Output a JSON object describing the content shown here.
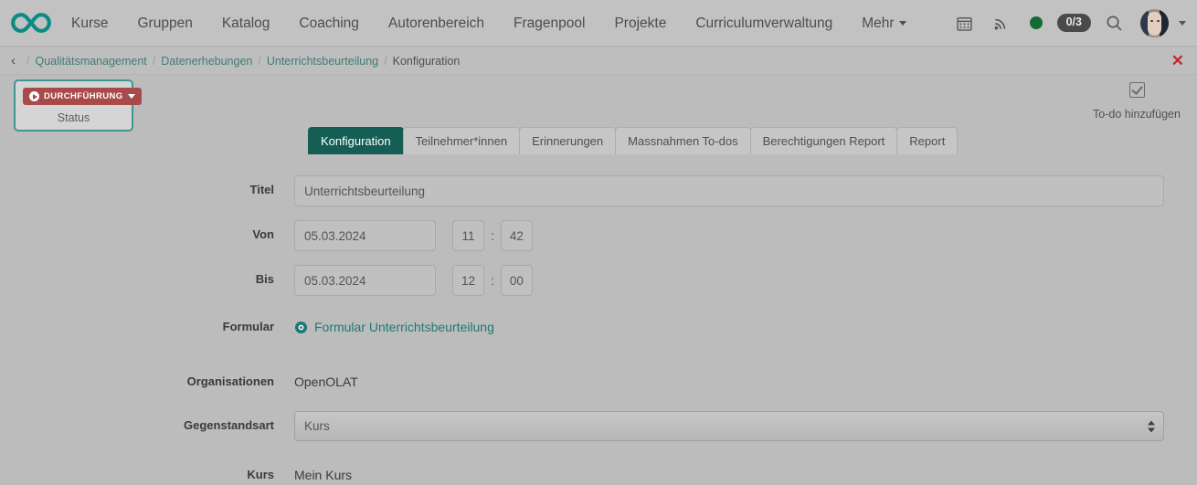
{
  "navbar": {
    "logo_name": "openolat-infinity-logo",
    "links": [
      {
        "label": "Kurse",
        "name": "nav-kurse"
      },
      {
        "label": "Gruppen",
        "name": "nav-gruppen"
      },
      {
        "label": "Katalog",
        "name": "nav-katalog"
      },
      {
        "label": "Coaching",
        "name": "nav-coaching"
      },
      {
        "label": "Autorenbereich",
        "name": "nav-autorenbereich"
      },
      {
        "label": "Fragenpool",
        "name": "nav-fragenpool"
      },
      {
        "label": "Projekte",
        "name": "nav-projekte"
      },
      {
        "label": "Curriculumverwaltung",
        "name": "nav-curriculumverwaltung"
      },
      {
        "label": "Mehr",
        "name": "nav-mehr",
        "has_caret": true
      }
    ],
    "calendar_icon": "calendar-icon",
    "rss_icon": "rss-icon",
    "status_dot_color": "#146b33",
    "count_badge": "0/3",
    "search_icon": "search-icon",
    "avatar_icon": "user-avatar"
  },
  "breadcrumb": {
    "back_glyph": "‹",
    "items": [
      {
        "label": "Qualitätsmanagement",
        "current": false
      },
      {
        "label": "Datenerhebungen",
        "current": false
      },
      {
        "label": "Unterrichtsbeurteilung",
        "current": false
      },
      {
        "label": "Konfiguration",
        "current": true
      }
    ],
    "separator": "/",
    "close_glyph": "✕"
  },
  "status_box": {
    "badge_label": "DURCHFÜHRUNG",
    "caption": "Status",
    "badge_color": "#a84a4a",
    "border_color": "#3f9690"
  },
  "todo": {
    "label": "To-do hinzufügen",
    "icon": "checkbox-checked-icon"
  },
  "tabs": [
    {
      "label": "Konfiguration",
      "active": true
    },
    {
      "label": "Teilnehmer*innen",
      "active": false
    },
    {
      "label": "Erinnerungen",
      "active": false
    },
    {
      "label": "Massnahmen To-dos",
      "active": false
    },
    {
      "label": "Berechtigungen Report",
      "active": false
    },
    {
      "label": "Report",
      "active": false
    }
  ],
  "form": {
    "titel": {
      "label": "Titel",
      "value": "Unterrichtsbeurteilung",
      "placeholder": "Titel"
    },
    "von": {
      "label": "Von",
      "date": "05.03.2024",
      "hour": "11",
      "minute": "42",
      "colon": ":"
    },
    "bis": {
      "label": "Bis",
      "date": "05.03.2024",
      "hour": "12",
      "minute": "00",
      "colon": ":"
    },
    "formular": {
      "label": "Formular",
      "link_text": "Formular Unterrichtsbeurteilung",
      "icon": "eye-icon",
      "link_color": "#1d7a71"
    },
    "organisationen": {
      "label": "Organisationen",
      "value": "OpenOLAT"
    },
    "gegenstandsart": {
      "label": "Gegenstandsart",
      "value": "Kurs",
      "options": [
        "Kurs"
      ]
    },
    "kurs": {
      "label": "Kurs",
      "value": "Mein Kurs"
    }
  }
}
